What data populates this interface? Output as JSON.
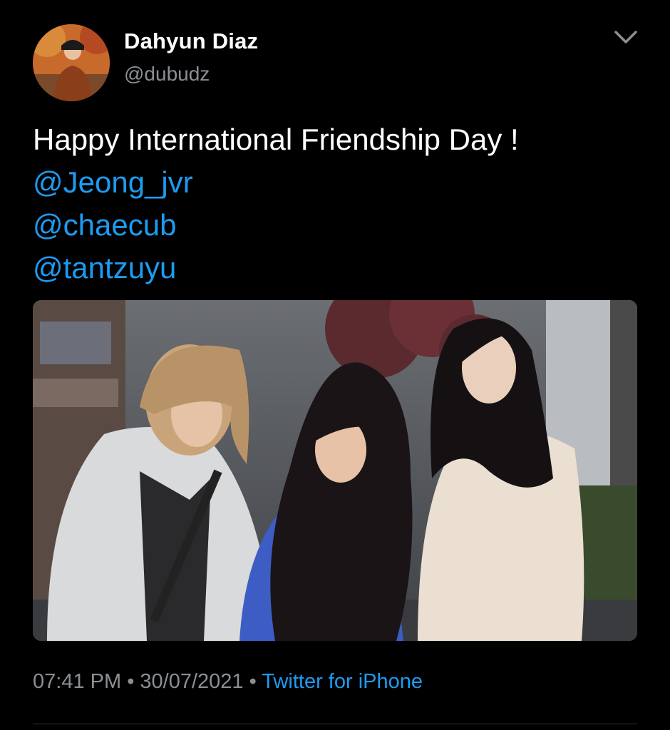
{
  "user": {
    "display_name": "Dahyun Diaz",
    "handle": "@dubudz"
  },
  "tweet": {
    "text": "Happy International Friendship Day !",
    "mentions": [
      "@Jeong_jvr",
      "@chaecub",
      "@tantzuyu"
    ]
  },
  "meta": {
    "time": "07:41 PM",
    "separator": "•",
    "date": "30/07/2021",
    "source": "Twitter for iPhone"
  },
  "icons": {
    "options": "chevron-down-icon"
  }
}
